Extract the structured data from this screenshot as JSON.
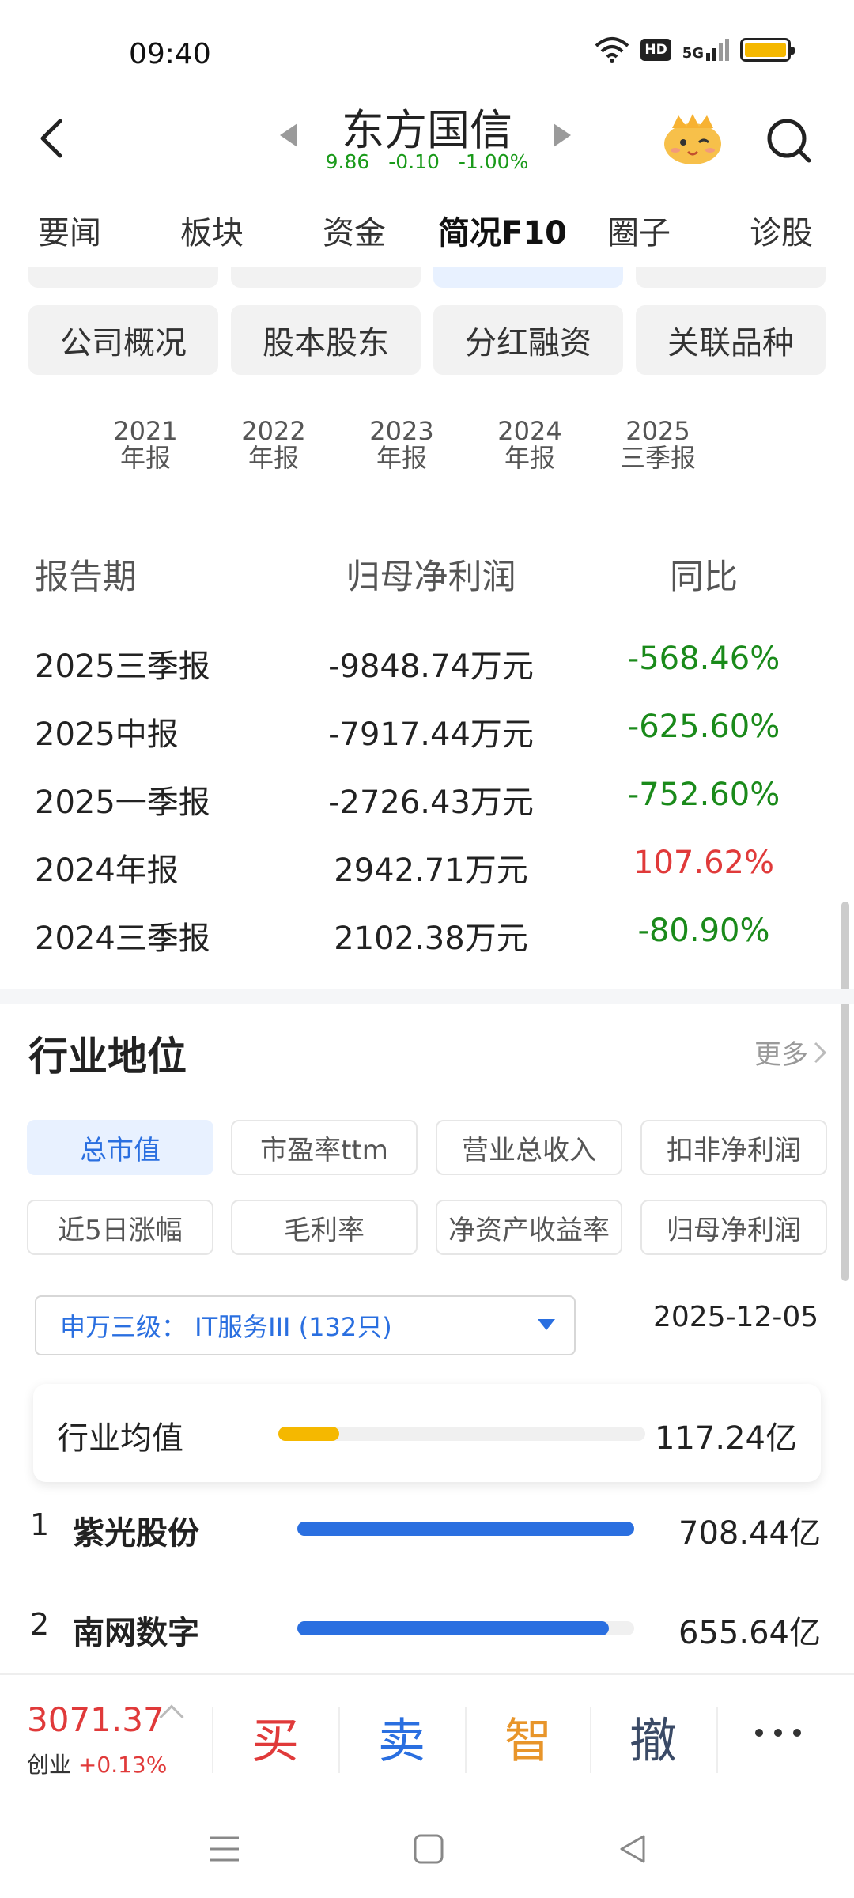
{
  "status_bar": {
    "time": "09:40",
    "hd": "HD",
    "network": "5G"
  },
  "header": {
    "stock_name": "东方国信",
    "price": "9.86",
    "change": "-0.10",
    "change_pct": "-1.00%"
  },
  "tabs": [
    {
      "label": "要闻"
    },
    {
      "label": "板块"
    },
    {
      "label": "资金"
    },
    {
      "label": "简况F10",
      "active": true
    },
    {
      "label": "圈子"
    },
    {
      "label": "诊股"
    }
  ],
  "sections": [
    "公司概况",
    "股本股东",
    "分红融资",
    "关联品种"
  ],
  "years": [
    {
      "year": "2021",
      "kind": "年报"
    },
    {
      "year": "2022",
      "kind": "年报"
    },
    {
      "year": "2023",
      "kind": "年报"
    },
    {
      "year": "2024",
      "kind": "年报"
    },
    {
      "year": "2025",
      "kind": "三季报"
    }
  ],
  "profit_table": {
    "headers": [
      "报告期",
      "归母净利润",
      "同比"
    ],
    "rows": [
      {
        "period": "2025三季报",
        "profit": "-9848.74万元",
        "yoy": "-568.46%",
        "trend": "down"
      },
      {
        "period": "2025中报",
        "profit": "-7917.44万元",
        "yoy": "-625.60%",
        "trend": "down"
      },
      {
        "period": "2025一季报",
        "profit": "-2726.43万元",
        "yoy": "-752.60%",
        "trend": "down"
      },
      {
        "period": "2024年报",
        "profit": "2942.71万元",
        "yoy": "107.62%",
        "trend": "up"
      },
      {
        "period": "2024三季报",
        "profit": "2102.38万元",
        "yoy": "-80.90%",
        "trend": "down"
      }
    ]
  },
  "industry": {
    "title": "行业地位",
    "more_label": "更多",
    "metrics": [
      {
        "label": "总市值",
        "active": true
      },
      {
        "label": "市盈率ttm"
      },
      {
        "label": "营业总收入"
      },
      {
        "label": "扣非净利润"
      },
      {
        "label": "近5日涨幅"
      },
      {
        "label": "毛利率"
      },
      {
        "label": "净资产收益率"
      },
      {
        "label": "归母净利润"
      }
    ],
    "selector": "申万三级： IT服务III (132只)",
    "date": "2025-12-05",
    "average": {
      "label": "行业均值",
      "value": "117.24亿",
      "level": 0.165
    },
    "ranking": [
      {
        "rank": "1",
        "name": "紫光股份",
        "value": "708.44亿",
        "level": 1.0
      },
      {
        "rank": "2",
        "name": "南网数字",
        "value": "655.64亿",
        "level": 0.925
      }
    ]
  },
  "trade_bar": {
    "index_value": "3071.37",
    "index_name": "创业",
    "index_change": "+0.13%",
    "buy": "买",
    "sell": "卖",
    "smart": "智",
    "cancel": "撤"
  },
  "colors": {
    "up": "#e03a3a",
    "down": "#1a8a1a",
    "accent": "#2a6fe0",
    "avg_bar": "#f5b800",
    "rank_bar": "#2a6fe0"
  }
}
